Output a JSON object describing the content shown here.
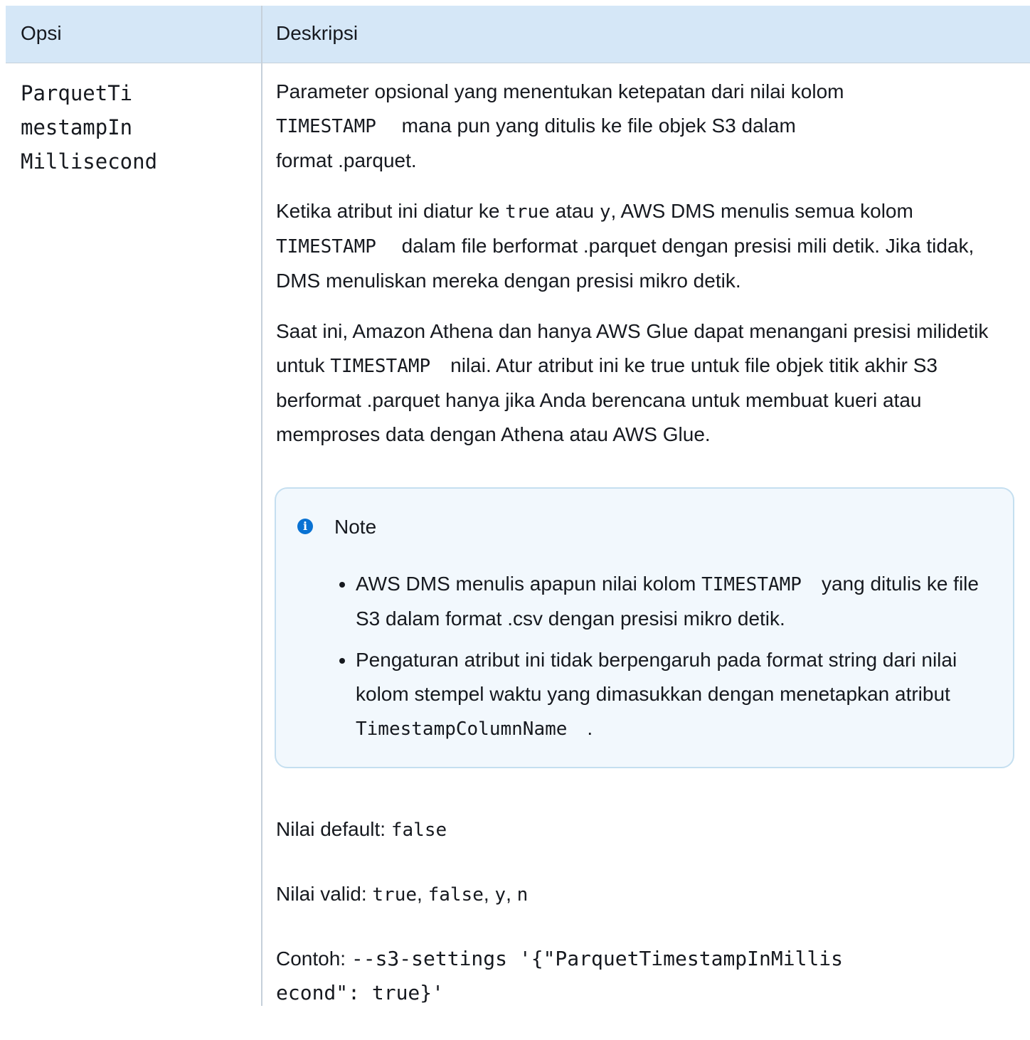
{
  "header": {
    "col_option": "Opsi",
    "col_description": "Deskripsi"
  },
  "option_name_lines": [
    "ParquetTi",
    "mestampIn",
    "Millisecond"
  ],
  "description": {
    "p1_text_a": "Parameter opsional yang menentukan ketepatan dari nilai kolom",
    "p1_code": "TIMESTAMP",
    "p1_text_b": "mana pun yang ditulis ke file objek S3 dalam",
    "p1_text_c": "format .parquet.",
    "p2_text_a": "Ketika atribut ini diatur ke ",
    "p2_code_true": "true",
    "p2_text_b": " atau ",
    "p2_code_y": "y",
    "p2_text_c": ", AWS DMS menulis semua kolom",
    "p2_code_ts": "TIMESTAMP",
    "p2_text_d": "dalam file berformat .parquet dengan presisi mili detik. Jika tidak, DMS menuliskan mereka dengan presisi mikro detik.",
    "p3_text_a": "Saat ini, Amazon Athena dan hanya AWS Glue dapat menangani presisi milidetik untuk ",
    "p3_code_ts": "TIMESTAMP",
    "p3_text_b": "nilai. Atur atribut ini ke true untuk file objek titik akhir S3 berformat .parquet hanya jika Anda berencana untuk membuat kueri atau memproses data dengan Athena atau AWS Glue."
  },
  "note": {
    "icon": "info-icon",
    "title": "Note",
    "item1_a": "AWS DMS menulis apapun nilai kolom ",
    "item1_code": "TIMESTAMP",
    "item1_b": "yang ditulis ke file S3 dalam format .csv dengan presisi mikro detik.",
    "item2_a": "Pengaturan atribut ini tidak berpengaruh pada format string dari nilai kolom stempel waktu yang dimasukkan dengan menetapkan atribut ",
    "item2_code": "TimestampColumnName",
    "item2_b": "."
  },
  "defaults": {
    "default_label": "Nilai default: ",
    "default_value": "false",
    "valid_label": "Nilai valid: ",
    "valid_values": [
      "true",
      "false",
      "y",
      "n"
    ],
    "sep": ", ",
    "example_label": "Contoh: ",
    "example_code_line1": "--s3-settings '{\"ParquetTimestampInMillis",
    "example_code_line2": "econd\": true}'"
  },
  "colors": {
    "header_bg": "#d5e7f7",
    "note_bg": "#f2f8fd",
    "note_border": "#c5dff0",
    "info_icon": "#0972d3"
  }
}
